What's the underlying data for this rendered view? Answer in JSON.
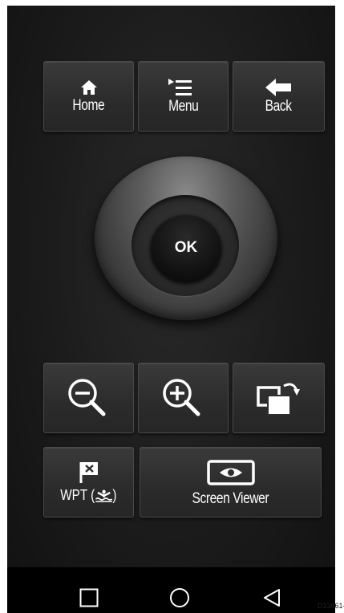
{
  "buttons": {
    "home_label": "Home",
    "menu_label": "Menu",
    "back_label": "Back",
    "ok_label": "OK",
    "wpt_label_prefix": "WPT (",
    "wpt_label_suffix": ")",
    "screen_viewer_label": "Screen Viewer"
  },
  "figure_code": "D13861-",
  "colors": {
    "background": "#1b1b1b",
    "button": "#2e2e2e",
    "text": "#ffffff"
  }
}
